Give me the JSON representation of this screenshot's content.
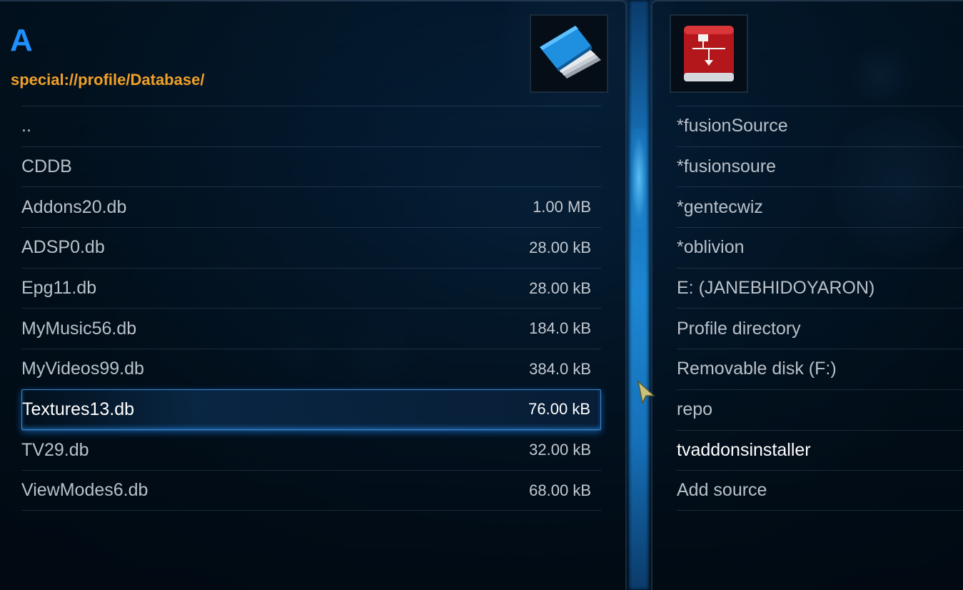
{
  "left_panel": {
    "header_letter": "A",
    "path": "special://profile/Database/",
    "thumbnail_icon": "document-stack-icon",
    "items": [
      {
        "label": "..",
        "size": ""
      },
      {
        "label": "CDDB",
        "size": ""
      },
      {
        "label": "Addons20.db",
        "size": "1.00 MB"
      },
      {
        "label": "ADSP0.db",
        "size": "28.00 kB"
      },
      {
        "label": "Epg11.db",
        "size": "28.00 kB"
      },
      {
        "label": "MyMusic56.db",
        "size": "184.0 kB"
      },
      {
        "label": "MyVideos99.db",
        "size": "384.0 kB"
      },
      {
        "label": "Textures13.db",
        "size": "76.00 kB",
        "selected": true
      },
      {
        "label": "TV29.db",
        "size": "32.00 kB"
      },
      {
        "label": "ViewModes6.db",
        "size": "68.00 kB"
      }
    ]
  },
  "right_panel": {
    "thumbnail_icon": "network-drive-icon",
    "items": [
      {
        "label": "*fusionSource"
      },
      {
        "label": "*fusionsoure"
      },
      {
        "label": "*gentecwiz"
      },
      {
        "label": "*oblivion"
      },
      {
        "label": "E: (JANEBHIDOYARON)"
      },
      {
        "label": "Profile directory"
      },
      {
        "label": "Removable disk (F:)"
      },
      {
        "label": "repo"
      },
      {
        "label": "tvaddonsinstaller",
        "highlight": true
      },
      {
        "label": "Add source"
      }
    ]
  },
  "colors": {
    "accent": "#1e90ff",
    "path": "#f0a028",
    "text": "#b9c0c8",
    "selection_border": "#3a86cc"
  },
  "cursor_icon": "mouse-pointer-icon"
}
